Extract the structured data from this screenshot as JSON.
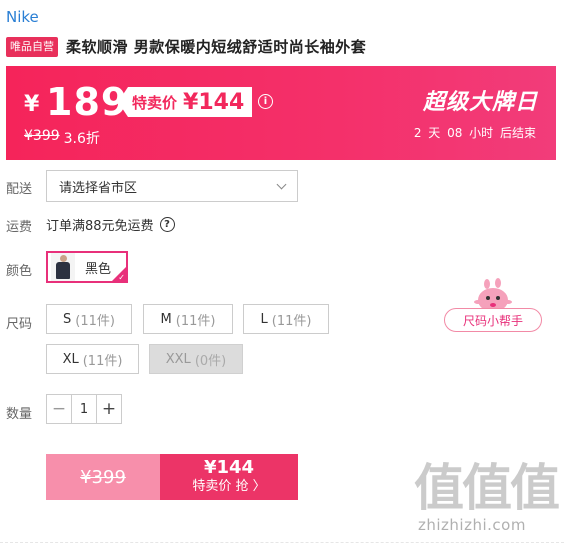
{
  "brand": "Nike",
  "product": {
    "badge": "唯品自营",
    "title": "柔软顺滑 男款保暖内短绒舒适时尚长袖外套"
  },
  "price": {
    "currency": "¥",
    "main": "189",
    "special_label": "特卖价",
    "special_price": "¥144",
    "info_icon": "i",
    "original": "¥399",
    "discount": "3.6折",
    "promo_title": "超级大牌日",
    "countdown": "2 天 08 小时 后结束",
    "accent_color": "#f5245a"
  },
  "delivery": {
    "label": "配送",
    "select_value": "请选择省市区"
  },
  "shipping": {
    "label": "运费",
    "text": "订单满88元免运费",
    "help_icon": "?"
  },
  "color": {
    "label": "颜色",
    "selected": "黑色"
  },
  "size": {
    "label": "尺码",
    "options": [
      {
        "name": "S",
        "count": "(11件)"
      },
      {
        "name": "M",
        "count": "(11件)"
      },
      {
        "name": "L",
        "count": "(11件)"
      },
      {
        "name": "XL",
        "count": "(11件)"
      },
      {
        "name": "XXL",
        "count": "(0件)",
        "disabled": true
      }
    ],
    "helper": "尺码小帮手"
  },
  "quantity": {
    "label": "数量",
    "minus": "−",
    "value": "1",
    "plus": "+"
  },
  "buy": {
    "original": "¥399",
    "price": "¥144",
    "label": "特卖价 抢 〉"
  },
  "watermark": {
    "glyphs": "值值值",
    "url": "zhizhizhi.com"
  }
}
